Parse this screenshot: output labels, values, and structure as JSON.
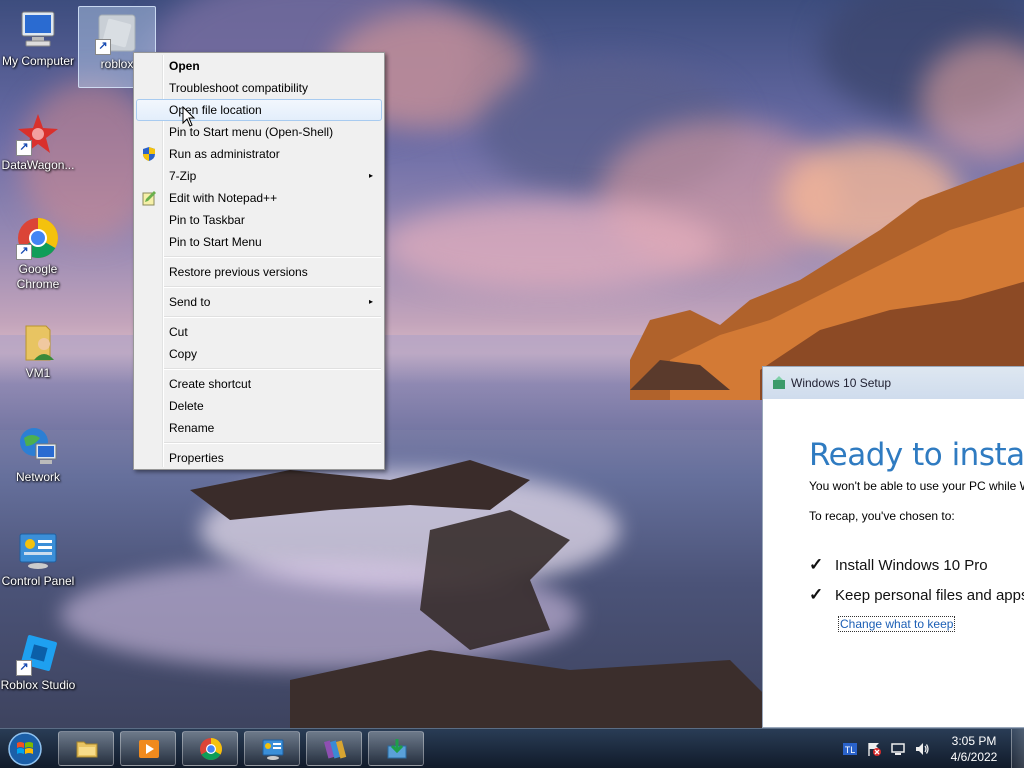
{
  "desktop": {
    "icons": [
      {
        "label": "My Computer"
      },
      {
        "label": "roblox"
      },
      {
        "label": "DataWagon..."
      },
      {
        "label": "Google Chrome"
      },
      {
        "label": "VM1"
      },
      {
        "label": "Network"
      },
      {
        "label": "Control Panel"
      },
      {
        "label": "Roblox Studio"
      }
    ]
  },
  "context_menu": {
    "items": [
      {
        "label": "Open"
      },
      {
        "label": "Troubleshoot compatibility"
      },
      {
        "label": "Open file location"
      },
      {
        "label": "Pin to Start menu (Open-Shell)"
      },
      {
        "label": "Run as administrator"
      },
      {
        "label": "7-Zip"
      },
      {
        "label": "Edit with Notepad++"
      },
      {
        "label": "Pin to Taskbar"
      },
      {
        "label": "Pin to Start Menu"
      },
      {
        "label": "Restore previous versions"
      },
      {
        "label": "Send to"
      },
      {
        "label": "Cut"
      },
      {
        "label": "Copy"
      },
      {
        "label": "Create shortcut"
      },
      {
        "label": "Delete"
      },
      {
        "label": "Rename"
      },
      {
        "label": "Properties"
      }
    ],
    "submenu_arrow": "▸",
    "highlighted_item": "Open file location"
  },
  "setup_window": {
    "title": "Windows 10 Setup",
    "heading": "Ready to install",
    "warning": "You won't be able to use your PC while W",
    "recap": "To recap, you've chosen to:",
    "checks": [
      {
        "tick": "✓",
        "label": "Install Windows 10 Pro"
      },
      {
        "tick": "✓",
        "label": "Keep personal files and apps"
      }
    ],
    "change_link": "Change what to keep",
    "accent_color": "#2f7bc1"
  },
  "taskbar": {
    "pinned": [
      "file-explorer-icon",
      "media-player-icon",
      "chrome-icon",
      "control-panel-icon",
      "winrar-icon",
      "setup-icon"
    ],
    "clock_time": "3:05 PM",
    "clock_date": "4/6/2022"
  }
}
